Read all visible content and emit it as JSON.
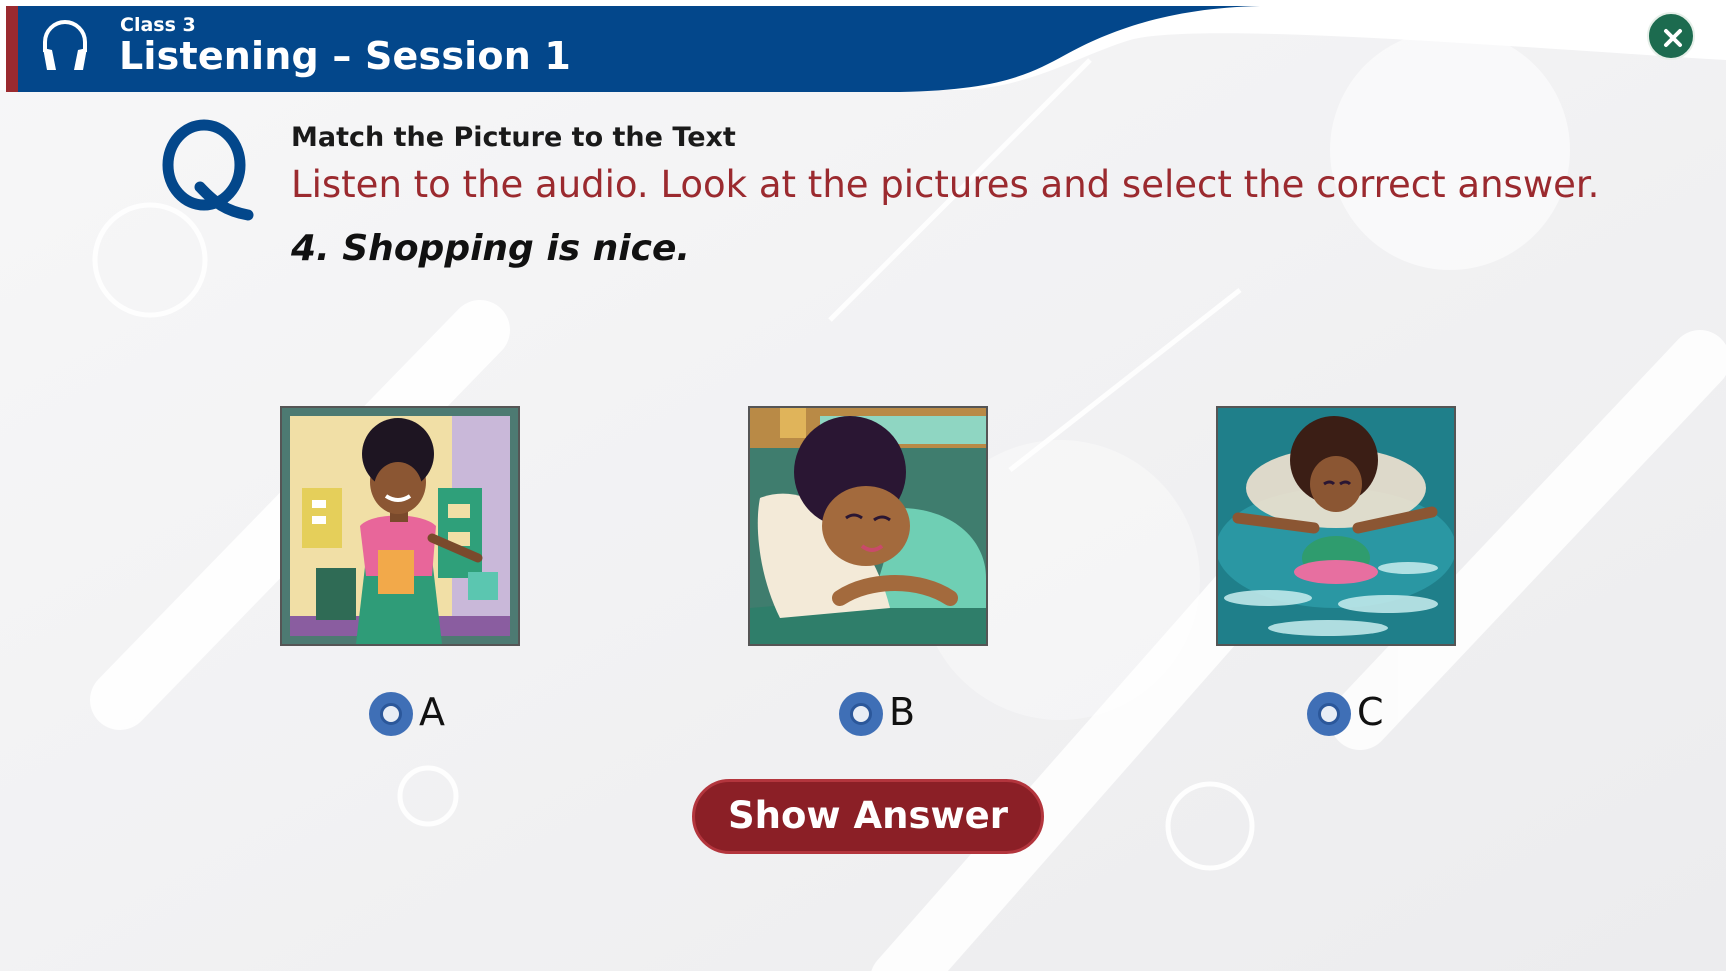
{
  "header": {
    "class_label": "Class 3",
    "title": "Listening – Session 1",
    "brand_color": "#03478b",
    "accent_color": "#9b2a2f",
    "icon": "headphones-icon",
    "close_icon": "close-icon"
  },
  "question": {
    "icon": "q-icon",
    "heading": "Match the Picture to the Text",
    "instruction": "Listen to the audio. Look at the pictures and select the correct answer.",
    "text": "4. Shopping is nice."
  },
  "options": [
    {
      "label": "A",
      "picture": "girl-shopping-picture"
    },
    {
      "label": "B",
      "picture": "girl-sleeping-picture"
    },
    {
      "label": "C",
      "picture": "girl-swimming-picture"
    }
  ],
  "actions": {
    "show_answer_label": "Show Answer",
    "button_color": "#8b1f26"
  }
}
